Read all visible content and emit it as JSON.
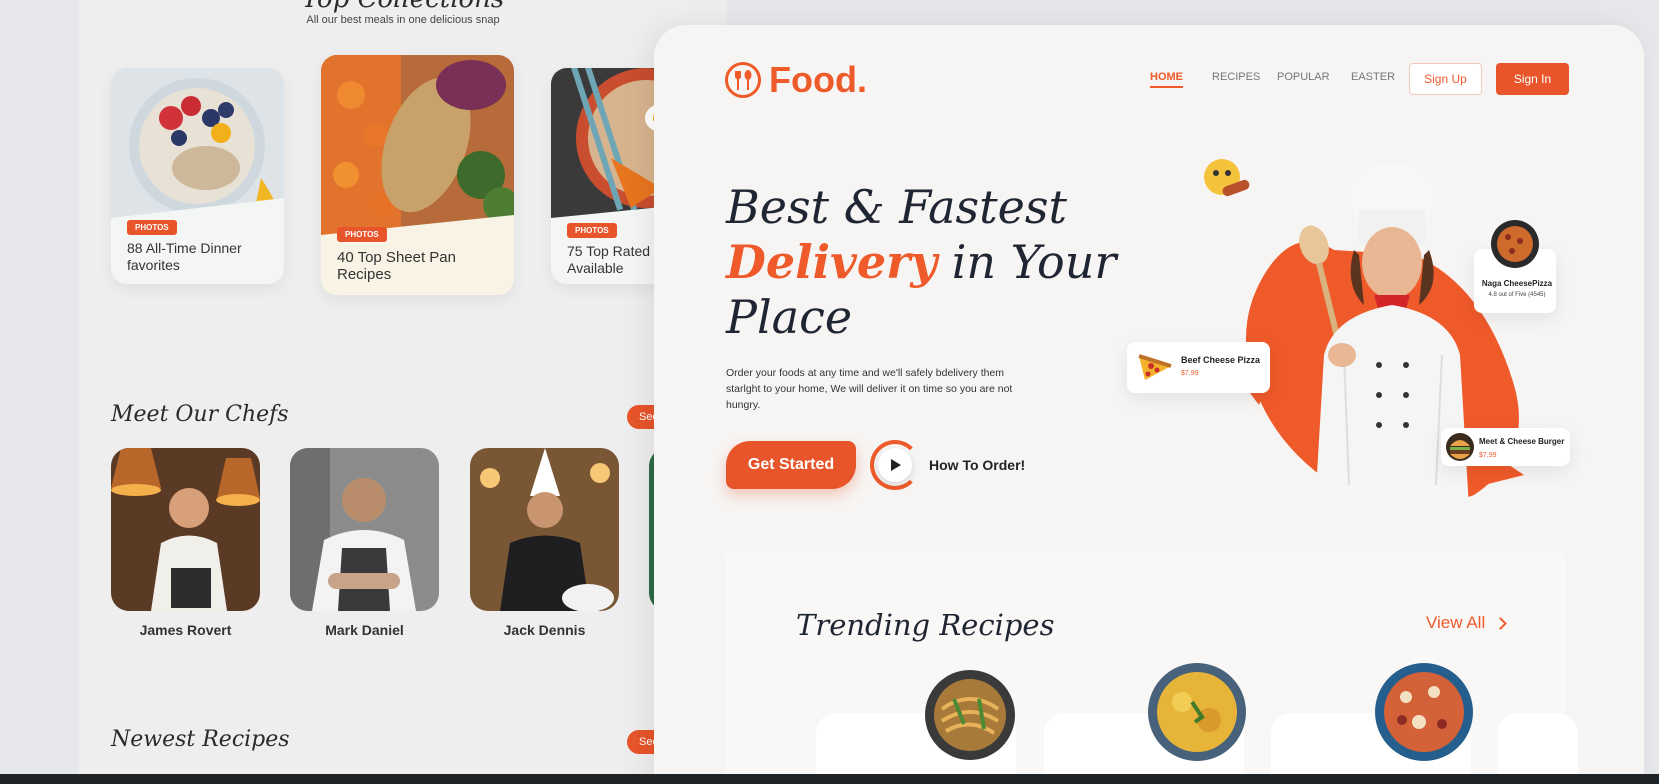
{
  "back": {
    "collections_title": "Top Collections",
    "collections_subtitle": "All our best meals in one delicious snap",
    "collections": [
      {
        "badge": "PHOTOS",
        "title": "88 All-Time Dinner favorites"
      },
      {
        "badge": "PHOTOS",
        "title": "40 Top Sheet Pan Recipes"
      },
      {
        "badge": "PHOTOS",
        "title": "75 Top Rated Available"
      }
    ],
    "chefs_title": "Meet Our Chefs",
    "see_all": "See",
    "chefs": [
      {
        "name": "James Rovert"
      },
      {
        "name": "Mark Daniel"
      },
      {
        "name": "Jack Dennis"
      }
    ],
    "newest_title": "Newest Recipes"
  },
  "front": {
    "logo": "Food.",
    "nav": [
      "HOME",
      "RECIPES",
      "POPULAR",
      "EASTER"
    ],
    "signup": "Sign Up",
    "signin": "Sign In",
    "hero_line1": "Best & Fastest",
    "hero_highlight": "Delivery",
    "hero_line2_rest": " in Your",
    "hero_line3": "Place",
    "description": "Order your foods at any time and we'll safely bdelivery them starlght to your home, We will deliver it on time so you are not hungry.",
    "get_started": "Get Started",
    "how_to_order": "How To Order!",
    "cards": {
      "pizza": {
        "name": "Beef Cheese Pizza",
        "price": "$7.99"
      },
      "naga": {
        "name": "Naga CheesePizza",
        "rating": "4.8 out of Five (4545)"
      },
      "burger": {
        "name": "Meet & Cheese Burger",
        "price": "$7.99"
      }
    },
    "trending_title": "Trending Recipes",
    "view_all": "View All"
  },
  "colors": {
    "accent": "#ef5a2a",
    "dark": "#1f2532"
  }
}
